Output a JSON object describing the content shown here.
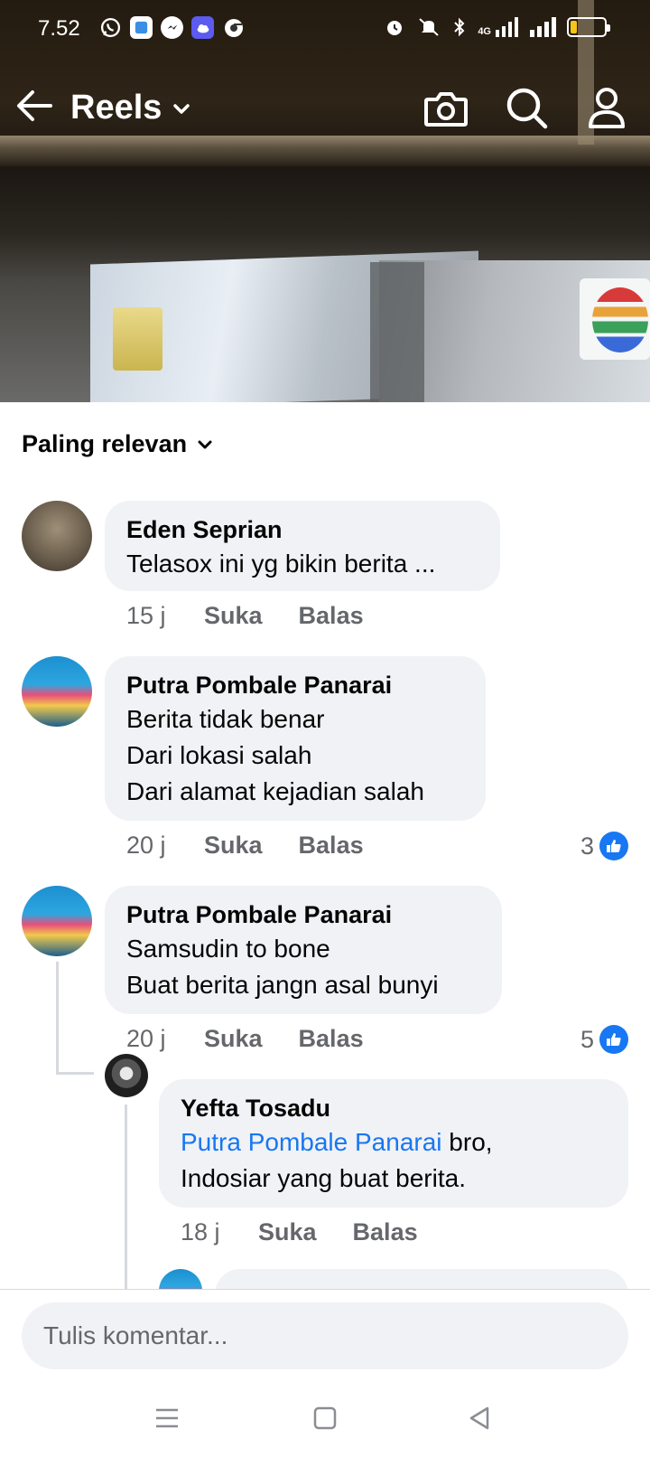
{
  "status_bar": {
    "time": "7.52",
    "network": "4G",
    "app_icons": [
      "whatsapp-icon",
      "app-icon-blue",
      "messenger-icon",
      "app-icon-cloud",
      "chrome-icon"
    ],
    "battery_level": 0.2
  },
  "header": {
    "title": "Reels"
  },
  "sort": {
    "label": "Paling relevan"
  },
  "comments": [
    {
      "author": "Eden Seprian",
      "lines": [
        "Telasox ini yg bikin berita ..."
      ],
      "time": "15 j",
      "like_label": "Suka",
      "reply_label": "Balas",
      "reactions": ""
    },
    {
      "author": "Putra Pombale Panarai",
      "lines": [
        "Berita tidak benar",
        "Dari lokasi salah",
        "Dari alamat kejadian salah"
      ],
      "time": "20 j",
      "like_label": "Suka",
      "reply_label": "Balas",
      "reactions": "3"
    },
    {
      "author": "Putra Pombale Panarai",
      "lines": [
        "Samsudin to bone",
        "Buat berita jangn asal bunyi"
      ],
      "time": "20 j",
      "like_label": "Suka",
      "reply_label": "Balas",
      "reactions": "5"
    },
    {
      "author": "Yefta Tosadu",
      "mention": "Putra Pombale Panarai",
      "lines": [
        " bro,",
        "Indosiar yang buat berita."
      ],
      "time": "18 j",
      "like_label": "Suka",
      "reply_label": "Balas",
      "reactions": ""
    }
  ],
  "composer": {
    "placeholder": "Tulis komentar..."
  },
  "colors": {
    "accent": "#1877f2",
    "bubble": "#f0f2f5",
    "meta_text": "#65676b"
  }
}
